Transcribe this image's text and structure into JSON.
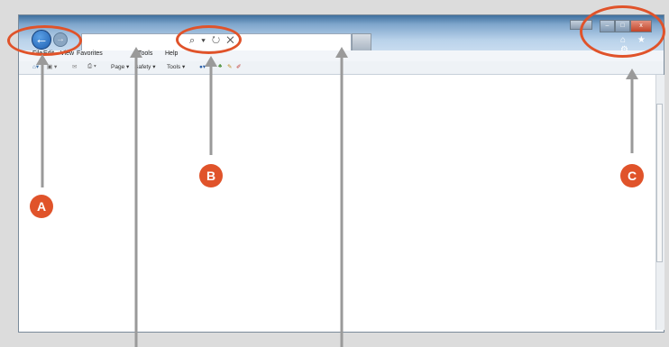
{
  "menu": {
    "file": "File",
    "edit": "Edit",
    "view": "View",
    "favorites": "Favorites",
    "tools": "Tools",
    "help": "Help"
  },
  "command_bar": {
    "page": "Page ▾",
    "safety": "Safety ▾",
    "tools": "Tools ▾"
  },
  "address_bar": {
    "icons": "⌕ ▾ ↻ ✕"
  },
  "window_controls": {
    "minimize": "–",
    "maximize": "□",
    "close": "x"
  },
  "toolbar_right_icons": "⌂ ★ ⚙",
  "callouts": {
    "a": "A",
    "b": "B",
    "c": "C"
  },
  "colors": {
    "callout": "#e0532a",
    "arrow": "#9a9a9a"
  }
}
